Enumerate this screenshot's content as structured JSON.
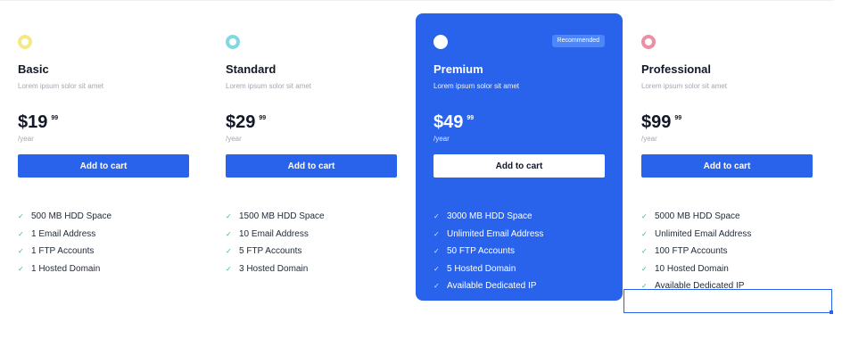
{
  "plans": [
    {
      "name": "Basic",
      "description": "Lorem ipsum solor sit amet",
      "price": "$19",
      "cents": "99",
      "period": "/year",
      "button": "Add to cart",
      "icon": "yellow-ring-icon",
      "features": [
        "500 MB HDD Space",
        "1 Email Address",
        "1 FTP Accounts",
        "1 Hosted Domain"
      ]
    },
    {
      "name": "Standard",
      "description": "Lorem ipsum solor sit amet",
      "price": "$29",
      "cents": "99",
      "period": "/year",
      "button": "Add to cart",
      "icon": "teal-ring-icon",
      "features": [
        "1500 MB HDD Space",
        "10 Email Address",
        "5 FTP Accounts",
        "3 Hosted Domain"
      ]
    },
    {
      "name": "Premium",
      "badge": "Recommended",
      "description": "Lorem ipsum solor sit amet",
      "price": "$49",
      "cents": "99",
      "period": "/year",
      "button": "Add to cart",
      "icon": "white-ring-icon",
      "features": [
        "3000 MB HDD Space",
        "Unlimited Email Address",
        "50 FTP Accounts",
        "5 Hosted Domain",
        "Available Dedicated IP"
      ]
    },
    {
      "name": "Professional",
      "description": "Lorem ipsum solor sit amet",
      "price": "$99",
      "cents": "99",
      "period": "/year",
      "button": "Add to cart",
      "icon": "pink-ring-icon",
      "features": [
        "5000 MB HDD Space",
        "Unlimited Email Address",
        "100 FTP Accounts",
        "10 Hosted Domain",
        "Available Dedicated IP"
      ]
    }
  ],
  "colors": {
    "accent": "#2a63eb",
    "check": "#38b98a",
    "basic_icon": "#f6e887",
    "standard_icon": "#81d8df",
    "professional_icon": "#ee8ea3"
  }
}
